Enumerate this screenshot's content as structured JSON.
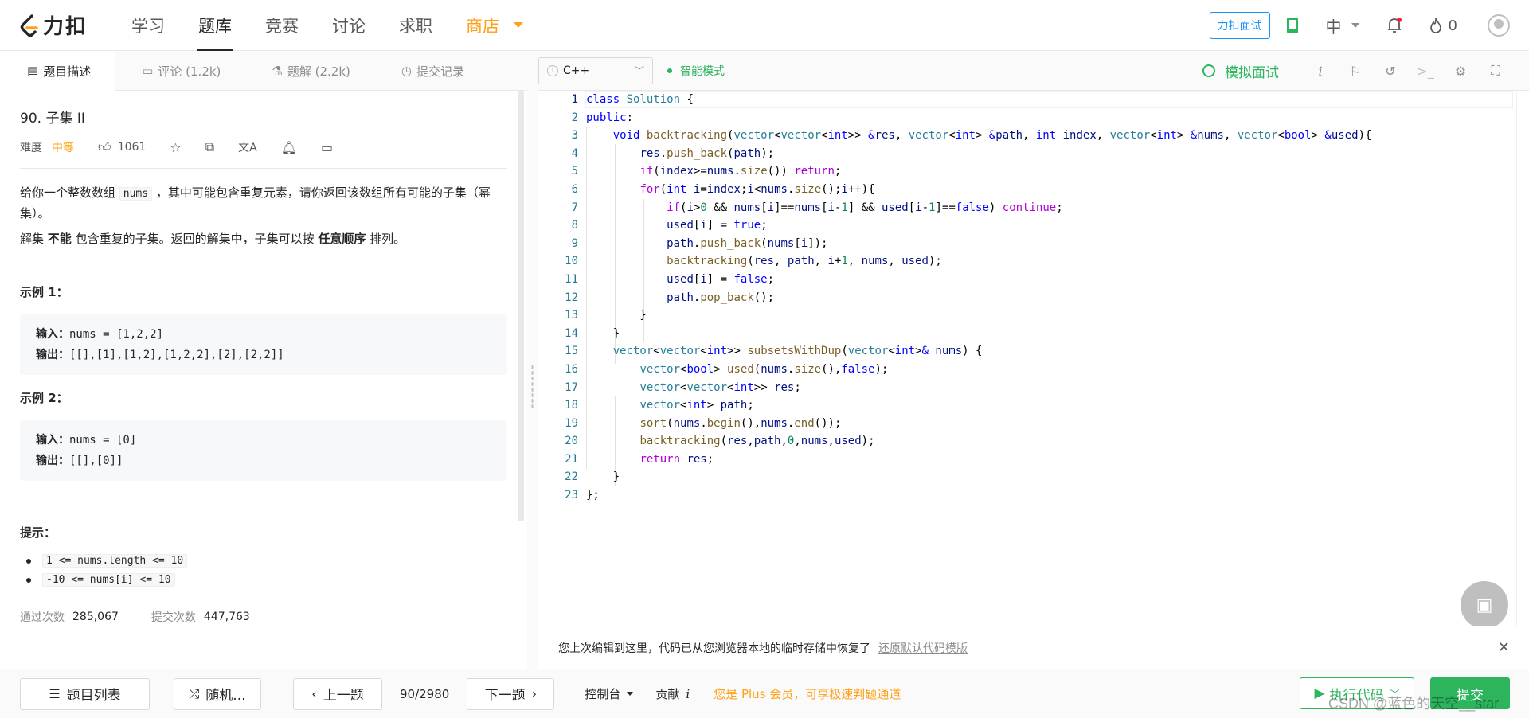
{
  "brand": {
    "name": "力扣",
    "accent": "#ffa116"
  },
  "nav": {
    "links": [
      {
        "label": "学习"
      },
      {
        "label": "题库"
      },
      {
        "label": "竞赛"
      },
      {
        "label": "讨论"
      },
      {
        "label": "求职"
      },
      {
        "label": "商店"
      }
    ],
    "interview_label": "力扣面试",
    "lang_label": "中",
    "points": "0"
  },
  "left_tabs": [
    {
      "label": "题目描述",
      "icon": "doc-icon"
    },
    {
      "label": "评论 (1.2k)",
      "icon": "comment-icon"
    },
    {
      "label": "题解 (2.2k)",
      "icon": "flask-icon"
    },
    {
      "label": "提交记录",
      "icon": "history-icon"
    }
  ],
  "problem": {
    "title": "90. 子集 II",
    "difficulty_label": "难度",
    "difficulty": "中等",
    "likes": "1061",
    "desc_p1_a": "给你一个整数数组 ",
    "desc_p1_code": "nums",
    "desc_p1_b": " ，其中可能包含重复元素，请你返回该数组所有可能的子集（幂集）。",
    "desc_p2_a": "解集 ",
    "desc_p2_b": "不能",
    "desc_p2_c": " 包含重复的子集。返回的解集中，子集可以按 ",
    "desc_p2_d": "任意顺序",
    "desc_p2_e": " 排列。",
    "example1_title": "示例 1：",
    "example1_input_label": "输入：",
    "example1_input": "nums = [1,2,2]",
    "example1_output_label": "输出：",
    "example1_output": "[[],[1],[1,2],[1,2,2],[2],[2,2]]",
    "example2_title": "示例 2：",
    "example2_input_label": "输入：",
    "example2_input": "nums = [0]",
    "example2_output_label": "输出：",
    "example2_output": "[[],[0]]",
    "hint_title": "提示：",
    "hints": [
      "1 <= nums.length <= 10",
      "-10 <= nums[i] <= 10"
    ],
    "accepted_label": "通过次数",
    "accepted": "285,067",
    "submissions_label": "提交次数",
    "submissions": "447,763"
  },
  "editor": {
    "language": "C++",
    "smart_mode": "智能模式",
    "mock_label": "模拟面试",
    "line_numbers": [
      "1",
      "2",
      "3",
      "4",
      "5",
      "6",
      "7",
      "8",
      "9",
      "10",
      "11",
      "12",
      "13",
      "14",
      "15",
      "16",
      "17",
      "18",
      "19",
      "20",
      "21",
      "22",
      "23"
    ],
    "restore_msg": "您上次编辑到这里，代码已从您浏览器本地的临时存储中恢复了",
    "restore_link": "还原默认代码模版"
  },
  "bottom": {
    "list_label": "题目列表",
    "random_label": "随机...",
    "prev_label": "上一题",
    "page": "90/2980",
    "next_label": "下一题",
    "console_label": "控制台",
    "contribute_label": "贡献",
    "plus_note": "您是 Plus 会员，可享极速判题通道",
    "run_label": "执行代码",
    "submit_label": "提交"
  },
  "watermark": "CSDN @蓝色的天空__star"
}
